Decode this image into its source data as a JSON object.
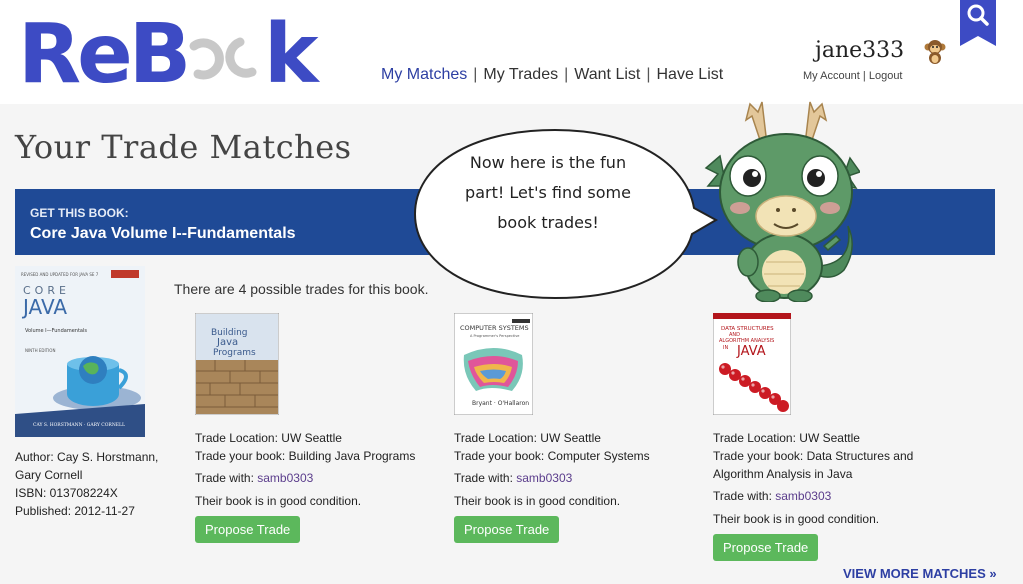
{
  "header": {
    "logo_text": "ReBook",
    "nav": [
      {
        "label": "My Matches",
        "active": true
      },
      {
        "label": "My Trades",
        "active": false
      },
      {
        "label": "Want List",
        "active": false
      },
      {
        "label": "Have List",
        "active": false
      }
    ],
    "separator": "|",
    "username": "jane333",
    "my_account": "My Account",
    "account_sep": "|",
    "logout": "Logout",
    "search_icon": "search-icon",
    "brand_color": "#3d4bc4",
    "accent_color": "#2d3fa3"
  },
  "page": {
    "title": "Your Trade Matches",
    "banner_label": "GET THIS BOOK:",
    "banner_title": "Core Java Volume I--Fundamentals",
    "banner_color": "#1f4a96"
  },
  "book": {
    "cover": {
      "top": "REVISED AND UPDATED FOR JAVA SE 7",
      "core": "CORE",
      "java": "JAVA",
      "volume": "Volume I—Fundamentals",
      "edition": "NINTH EDITION",
      "authors": "CAY S. HORSTMANN · GARY CORNELL"
    },
    "author": "Author: Cay S. Horstmann, Gary Cornell",
    "isbn": "ISBN: 013708224X",
    "published": "Published: 2012-11-27"
  },
  "possible_trades": "There are 4 possible trades for this book.",
  "matches": [
    {
      "location": "Trade Location: UW Seattle",
      "your_book": "Trade your book: Building Java Programs",
      "trade_with_label": "Trade with: ",
      "trade_with_user": "samb0303",
      "condition": "Their book is in good condition.",
      "propose": "Propose Trade",
      "cover_title": "Building Java Programs"
    },
    {
      "location": "Trade Location: UW Seattle",
      "your_book": "Trade your book: Computer Systems",
      "trade_with_label": "Trade with: ",
      "trade_with_user": "samb0303",
      "condition": "Their book is in good condition.",
      "propose": "Propose Trade",
      "cover_title": "Computer Systems",
      "cover_sub": "A Programmer's Perspective",
      "cover_authors": "Bryant · O'Hallaron"
    },
    {
      "location": "Trade Location: UW Seattle",
      "your_book": "Trade your book: Data Structures and Algorithm Analysis in Java",
      "trade_with_label": "Trade with: ",
      "trade_with_user": "samb0303",
      "condition": "Their book is in good condition.",
      "propose": "Propose Trade",
      "cover_title": "Data Structures and Algorithm Analysis in Java"
    }
  ],
  "view_more": "VIEW MORE MATCHES »",
  "mascot": {
    "speech": "Now here is the fun part! Let's find some book trades!"
  }
}
